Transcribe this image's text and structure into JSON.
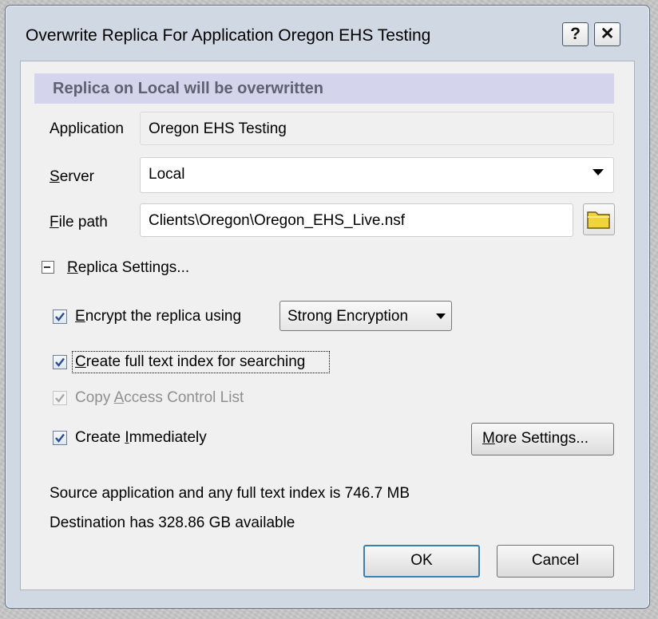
{
  "dialog": {
    "title": "Overwrite Replica For Application Oregon EHS Testing",
    "help_glyph": "?",
    "close_glyph": "✕"
  },
  "banner": {
    "text": "Replica on Local will be overwritten"
  },
  "fields": {
    "application": {
      "label": "Application",
      "value": "Oregon EHS Testing"
    },
    "server": {
      "label_first": "S",
      "label_rest": "erver",
      "value": "Local"
    },
    "file_path": {
      "label_first": "F",
      "label_rest": "ile path",
      "value": "Clients\\Oregon\\Oregon_EHS_Live.nsf"
    }
  },
  "replica_settings": {
    "label_first": "R",
    "label_rest": "eplica Settings...",
    "encrypt": {
      "checked": true,
      "label_first": "E",
      "label_rest": "ncrypt the replica using",
      "option": "Strong Encryption"
    },
    "full_text": {
      "checked": true,
      "label_first": "C",
      "label_rest": "reate full text index for searching"
    },
    "copy_acl": {
      "checked": true,
      "disabled": true,
      "label_pre": "Copy ",
      "label_ul": "A",
      "label_post": "ccess Control List"
    },
    "create_immediately": {
      "checked": true,
      "label_pre": "Create ",
      "label_ul": "I",
      "label_post": "mmediately"
    },
    "more_settings": {
      "label_first": "M",
      "label_rest": "ore Settings..."
    }
  },
  "info": {
    "source": "Source application and any full text index is 746.7 MB",
    "destination": "Destination has 328.86 GB available"
  },
  "buttons": {
    "ok": "OK",
    "cancel": "Cancel"
  },
  "colors": {
    "banner_bg": "#d4d4ec",
    "banner_text": "#5f6170",
    "check_blue": "#2a4d8f",
    "frame": "#cfd8e3"
  }
}
